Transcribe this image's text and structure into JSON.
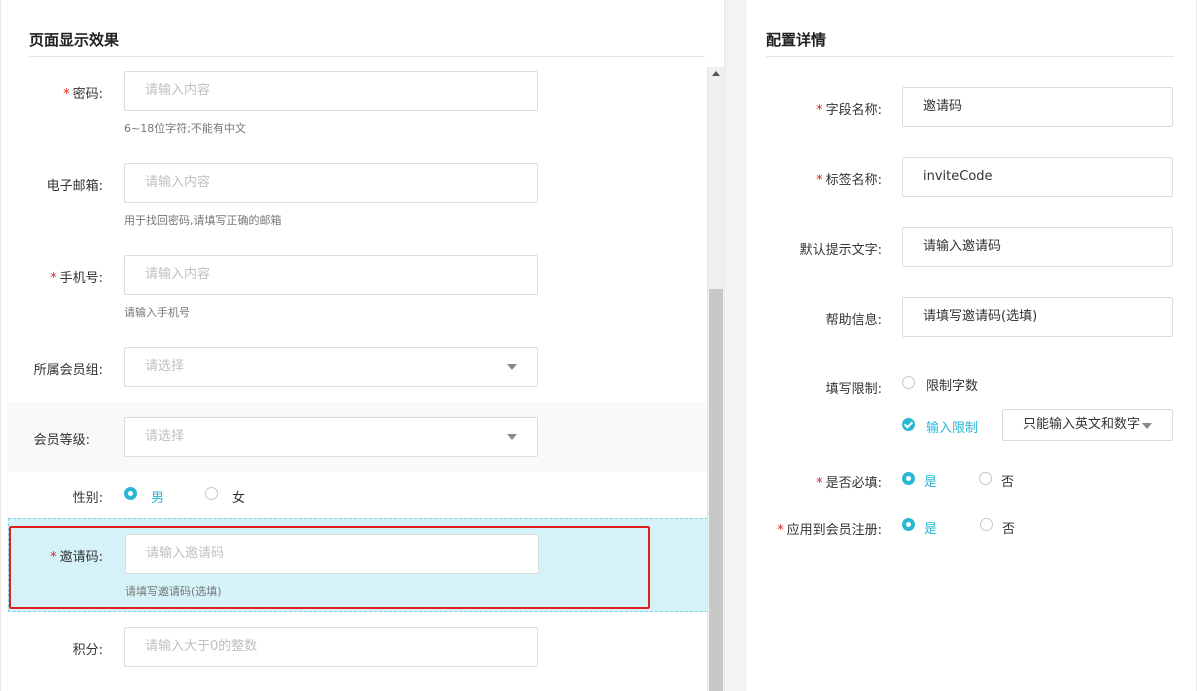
{
  "left": {
    "title": "页面显示效果",
    "fields": {
      "password": {
        "label": "密码:",
        "required": "*",
        "placeholder": "请输入内容",
        "help": "6~18位字符;不能有中文"
      },
      "email": {
        "label": "电子邮箱:",
        "placeholder": "请输入内容",
        "help": "用于找回密码,请填写正确的邮箱"
      },
      "phone": {
        "label": "手机号:",
        "required": "*",
        "placeholder": "请输入内容",
        "help": "请输入手机号"
      },
      "member_group": {
        "label": "所属会员组:",
        "placeholder": "请选择"
      },
      "member_level": {
        "label": "会员等级:",
        "placeholder": "请选择"
      },
      "gender": {
        "label": "性别:",
        "options": [
          "男",
          "女"
        ],
        "selected": "男"
      },
      "invite_code": {
        "label": "邀请码:",
        "required": "*",
        "placeholder": "请输入邀请码",
        "help": "请填写邀请码(选填)"
      },
      "points": {
        "label": "积分:",
        "placeholder": "请输入大于0的整数"
      }
    }
  },
  "right": {
    "title": "配置详情",
    "field_name": {
      "label": "字段名称:",
      "required": "*",
      "value": "邀请码"
    },
    "tag_name": {
      "label": "标签名称:",
      "required": "*",
      "value": "inviteCode"
    },
    "default_hint": {
      "label": "默认提示文字:",
      "value": "请输入邀请码"
    },
    "help_info": {
      "label": "帮助信息:",
      "value": "请填写邀请码(选填)"
    },
    "limit": {
      "label": "填写限制:",
      "option_chars": "限制字数",
      "option_input": "输入限制",
      "select_value": "只能输入英文和数字"
    },
    "required": {
      "label": "是否必填:",
      "required": "*",
      "yes": "是",
      "no": "否"
    },
    "apply_register": {
      "label": "应用到会员注册:",
      "required": "*",
      "yes": "是",
      "no": "否"
    }
  },
  "colors": {
    "accent": "#2ab7d5",
    "required": "#e02020",
    "selected_bg": "#d4f2f7"
  },
  "icons": [
    "radio-icon",
    "check-icon",
    "chevron-down-icon",
    "scroll-up-icon"
  ]
}
